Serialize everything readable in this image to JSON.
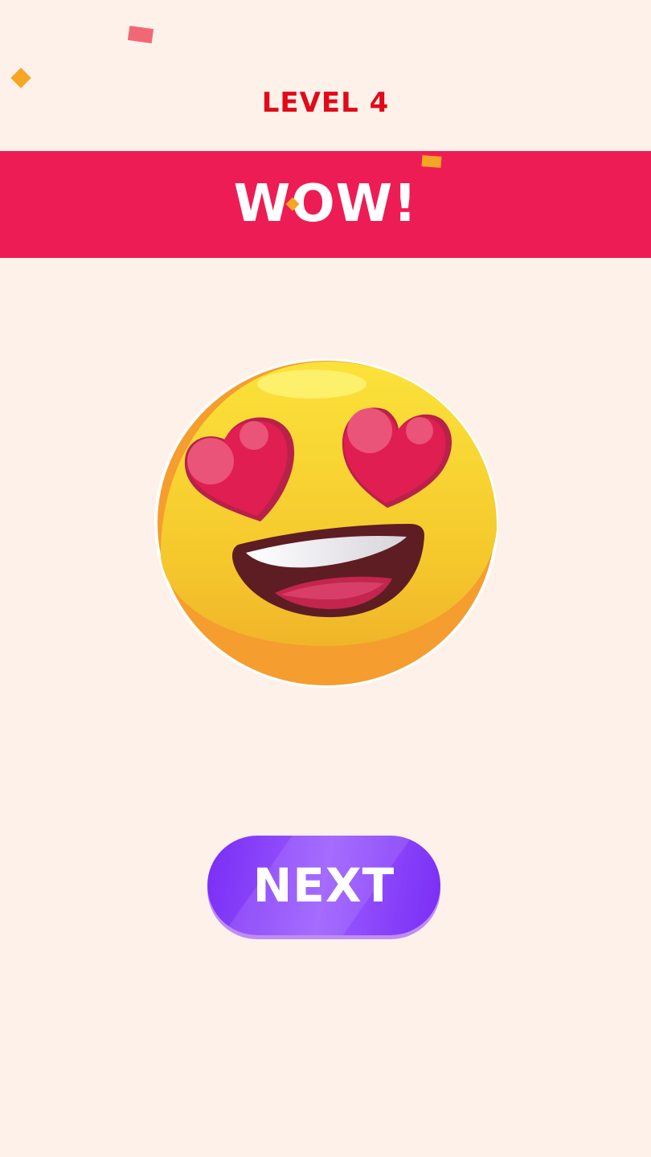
{
  "header": {
    "level_label": "LEVEL 4"
  },
  "banner": {
    "text": "WOW!",
    "color": "#ee1c54"
  },
  "emoji": {
    "icon": "heart-eyes-emoji-icon"
  },
  "buttons": {
    "next_label": "NEXT",
    "color": "#7a2df5"
  },
  "theme": {
    "background": "#fdf1ea",
    "level_text_color": "#e10a18",
    "confetti_colors": [
      "#f26776",
      "#f6a623"
    ]
  }
}
